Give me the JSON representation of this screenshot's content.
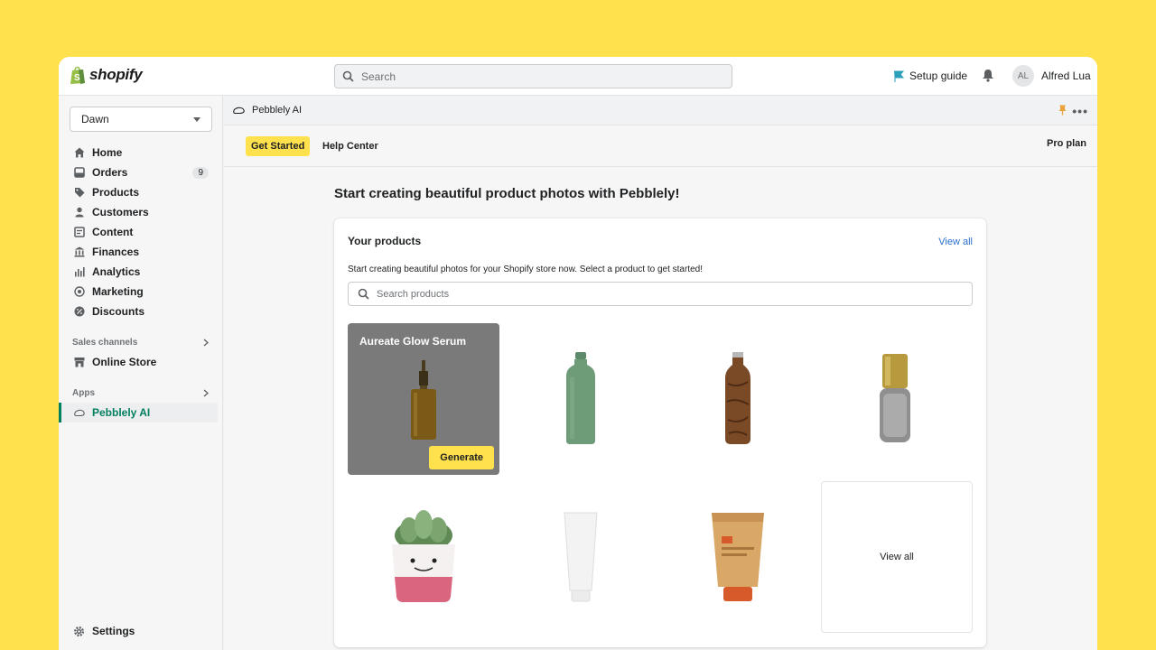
{
  "topbar": {
    "brand": "shopify",
    "search_placeholder": "Search",
    "setup_label": "Setup guide",
    "avatar_initials": "AL",
    "user_name": "Alfred Lua"
  },
  "sidebar": {
    "store": "Dawn",
    "items": [
      {
        "label": "Home",
        "icon": "home-icon"
      },
      {
        "label": "Orders",
        "icon": "orders-icon",
        "badge": "9"
      },
      {
        "label": "Products",
        "icon": "tag-icon"
      },
      {
        "label": "Customers",
        "icon": "person-icon"
      },
      {
        "label": "Content",
        "icon": "content-icon"
      },
      {
        "label": "Finances",
        "icon": "bank-icon"
      },
      {
        "label": "Analytics",
        "icon": "analytics-icon"
      },
      {
        "label": "Marketing",
        "icon": "target-icon"
      },
      {
        "label": "Discounts",
        "icon": "discount-icon"
      }
    ],
    "sales_channels_label": "Sales channels",
    "online_store": "Online Store",
    "apps_label": "Apps",
    "app_item": "Pebblely AI",
    "settings": "Settings"
  },
  "app": {
    "title": "Pebblely AI",
    "tab_get_started": "Get Started",
    "tab_help": "Help Center",
    "plan": "Pro plan"
  },
  "main": {
    "headline": "Start creating beautiful product photos with Pebblely!",
    "card_title": "Your products",
    "view_all_link": "View all",
    "description": "Start creating beautiful photos for your Shopify store now. Select a product to get started!",
    "search_placeholder": "Search products",
    "selected_product": "Aureate Glow Serum",
    "generate_label": "Generate",
    "view_all_tile": "View all"
  },
  "colors": {
    "background": "#FEE14D",
    "accent": "#FEE14D",
    "active_nav": "#008060",
    "link": "#2C6ECB"
  }
}
